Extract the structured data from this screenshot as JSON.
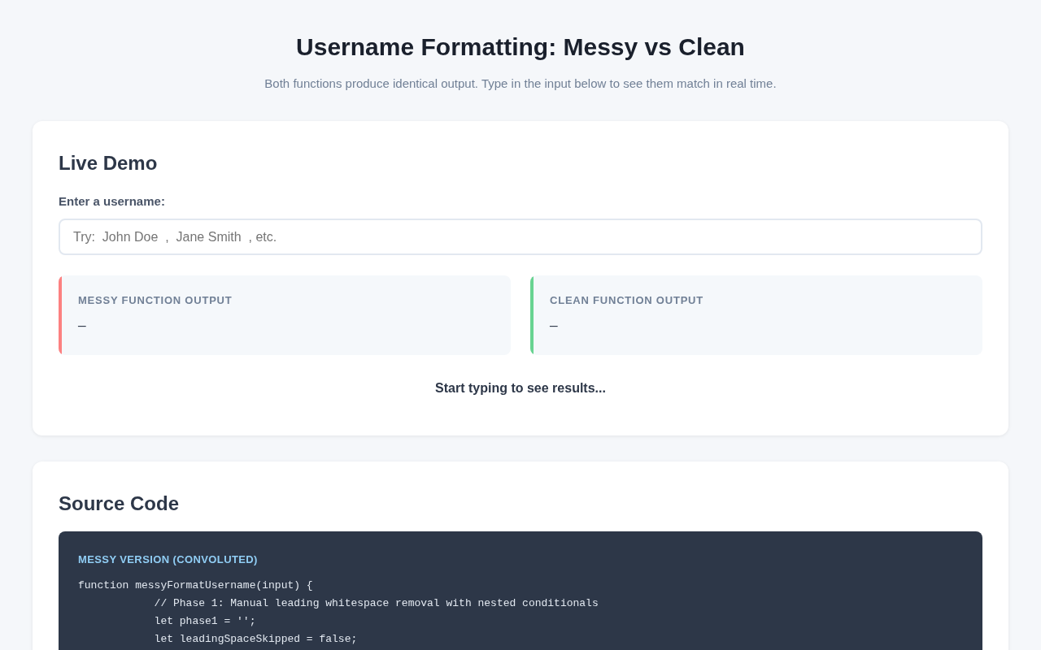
{
  "header": {
    "title": "Username Formatting: Messy vs Clean",
    "subtitle": "Both functions produce identical output. Type in the input below to see them match in real time."
  },
  "live_demo": {
    "heading": "Live Demo",
    "input_label": "Enter a username:",
    "input": {
      "placeholder": "Try:  John Doe  ,  Jane Smith  , etc."
    },
    "outputs": [
      {
        "label": "MESSY FUNCTION OUTPUT",
        "value": "—",
        "color": "#fc8181"
      },
      {
        "label": "CLEAN FUNCTION OUTPUT",
        "value": "—",
        "color": "#68d391"
      }
    ],
    "status": "Start typing to see results..."
  },
  "source_code": {
    "heading": "Source Code",
    "blocks": [
      {
        "caption": "MESSY VERSION (CONVOLUTED)",
        "lines": [
          "function messyFormatUsername(input) {",
          "            // Phase 1: Manual leading whitespace removal with nested conditionals",
          "            let phase1 = '';",
          "            let leadingSpaceSkipped = false;"
        ]
      }
    ]
  }
}
